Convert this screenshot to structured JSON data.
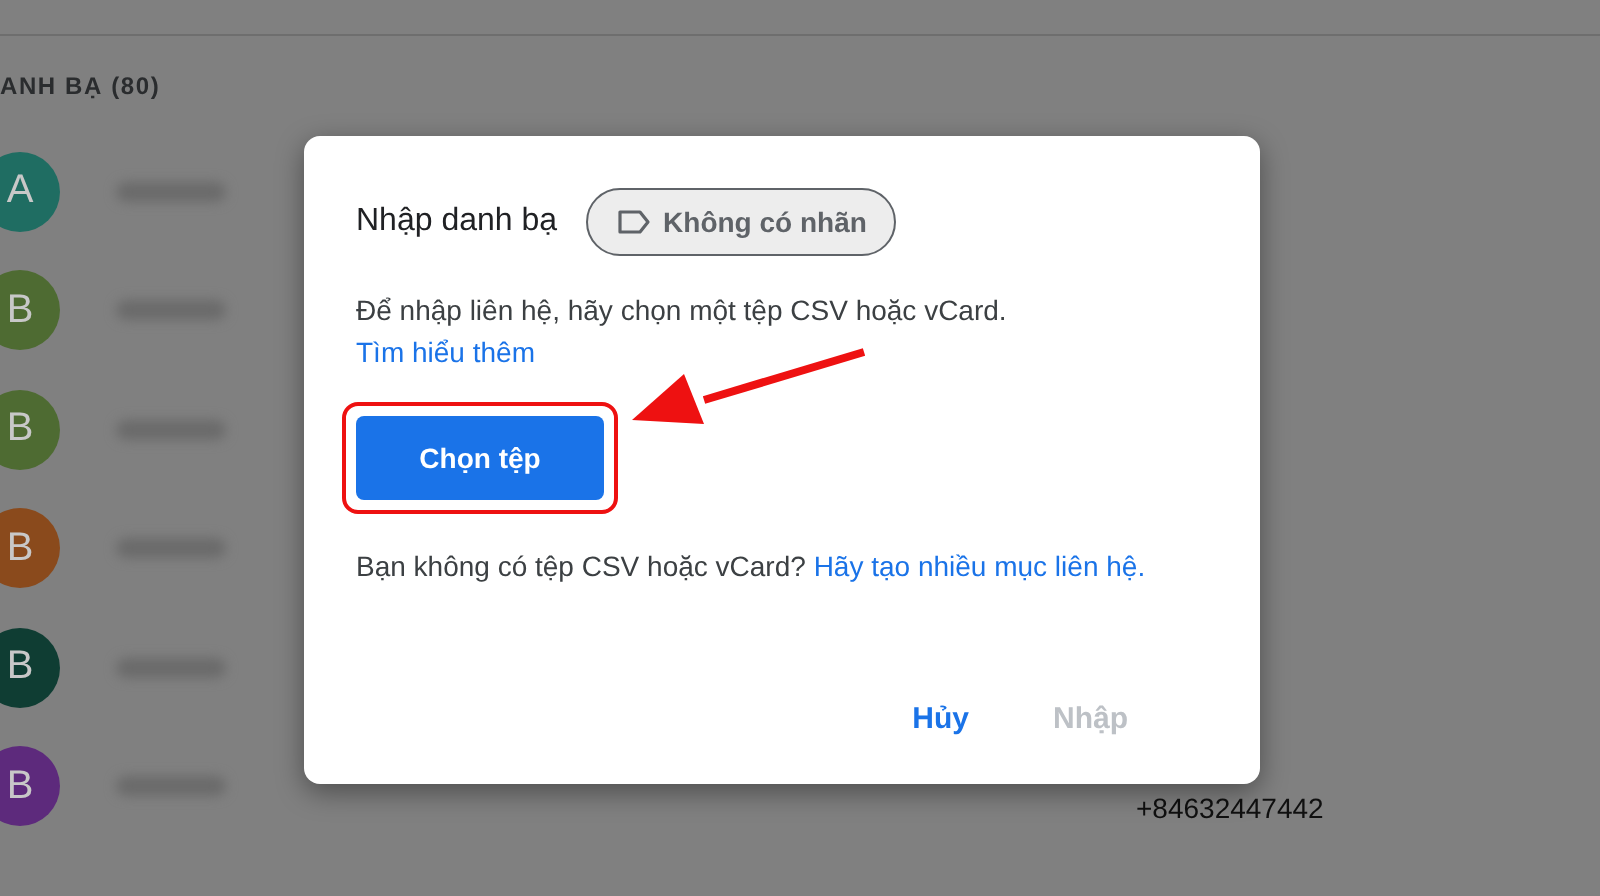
{
  "list_header": "ANH BẠ (80)",
  "contacts": [
    {
      "initial": "A",
      "color": "#1f6d62"
    },
    {
      "initial": "B",
      "color": "#4e6b32"
    },
    {
      "initial": "B",
      "color": "#4e6b32"
    },
    {
      "initial": "B",
      "color": "#8a4a1c"
    },
    {
      "initial": "B",
      "color": "#0f3d33"
    },
    {
      "initial": "B",
      "color": "#5d2a7c",
      "phone": "+84632447442"
    }
  ],
  "dialog": {
    "title": "Nhập danh bạ",
    "label_chip": "Không có nhãn",
    "description": "Để nhập liên hệ, hãy chọn một tệp CSV hoặc vCard.",
    "description_link": "Tìm hiểu thêm",
    "choose_button": "Chọn tệp",
    "note": "Bạn không có tệp CSV hoặc vCard?",
    "note_link": "Hãy tạo nhiều mục liên hệ.",
    "actions": [
      {
        "label": "Hủy",
        "disabled": false
      },
      {
        "label": "Nhập",
        "disabled": true
      }
    ]
  }
}
